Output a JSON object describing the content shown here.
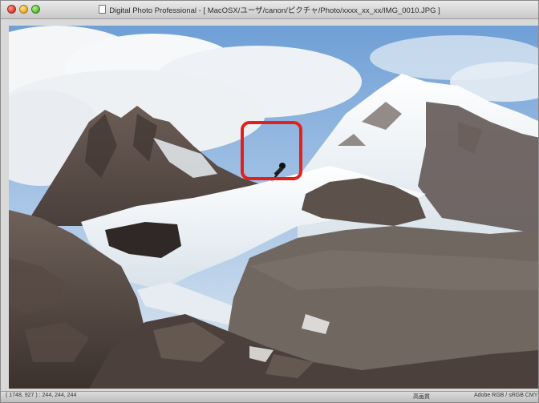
{
  "window": {
    "title": "Digital Photo Professional - [ MacOSX/ユーザ/canon/ピクチャ/Photo/xxxx_xx_xx/IMG_0010.JPG ]"
  },
  "status": {
    "pixel_readout": "( 1748,  927 ) : 244, 244, 244",
    "quality": "高画質",
    "color_space": "Adobe RGB / sRGB  CMY"
  },
  "image": {
    "subject": "glacier-mountain-photo"
  },
  "tool": {
    "cursor": "eyedropper-icon"
  },
  "colors": {
    "highlight": "#e2211c"
  }
}
